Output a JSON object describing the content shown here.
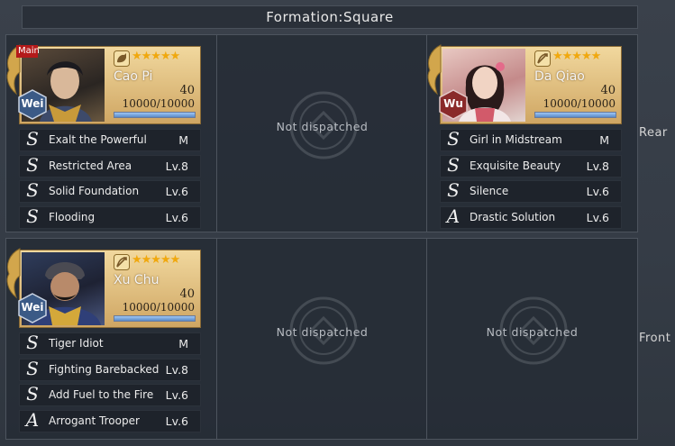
{
  "formation_title": "Formation:Square",
  "row_labels": {
    "rear": "Rear",
    "front": "Front"
  },
  "empty_label": "Not dispatched",
  "rear": {
    "slot1": {
      "main_badge": "Main",
      "name": "Cao Pi",
      "faction": "Wei",
      "level": "40",
      "troops": "10000/10000",
      "troop_ratio": 1.0,
      "stars": "★★★★★",
      "class_icon": "cavalry-icon",
      "skills": [
        {
          "grade": "S",
          "name": "Exalt the Powerful",
          "level": "M"
        },
        {
          "grade": "S",
          "name": "Restricted Area",
          "level": "Lv.8"
        },
        {
          "grade": "S",
          "name": "Solid Foundation",
          "level": "Lv.6"
        },
        {
          "grade": "S",
          "name": "Flooding",
          "level": "Lv.6"
        }
      ]
    },
    "slot3": {
      "name": "Da Qiao",
      "faction": "Wu",
      "level": "40",
      "troops": "10000/10000",
      "troop_ratio": 1.0,
      "stars": "★★★★★",
      "class_icon": "archer-icon",
      "skills": [
        {
          "grade": "S",
          "name": "Girl in Midstream",
          "level": "M"
        },
        {
          "grade": "S",
          "name": "Exquisite Beauty",
          "level": "Lv.8"
        },
        {
          "grade": "S",
          "name": "Silence",
          "level": "Lv.6"
        },
        {
          "grade": "A",
          "name": "Drastic Solution",
          "level": "Lv.6"
        }
      ]
    }
  },
  "front": {
    "slot1": {
      "name": "Xu Chu",
      "faction": "Wei",
      "level": "40",
      "troops": "10000/10000",
      "troop_ratio": 1.0,
      "stars": "★★★★★",
      "class_icon": "archer-icon",
      "skills": [
        {
          "grade": "S",
          "name": "Tiger Idiot",
          "level": "M"
        },
        {
          "grade": "S",
          "name": "Fighting Barebacked",
          "level": "Lv.8"
        },
        {
          "grade": "S",
          "name": "Add Fuel to the Fire",
          "level": "Lv.6"
        },
        {
          "grade": "A",
          "name": "Arrogant Trooper",
          "level": "Lv.6"
        }
      ]
    }
  },
  "colors": {
    "faction_wei": "#3b5a86",
    "faction_wu": "#8a2a2a",
    "star": "#f0a80e"
  }
}
